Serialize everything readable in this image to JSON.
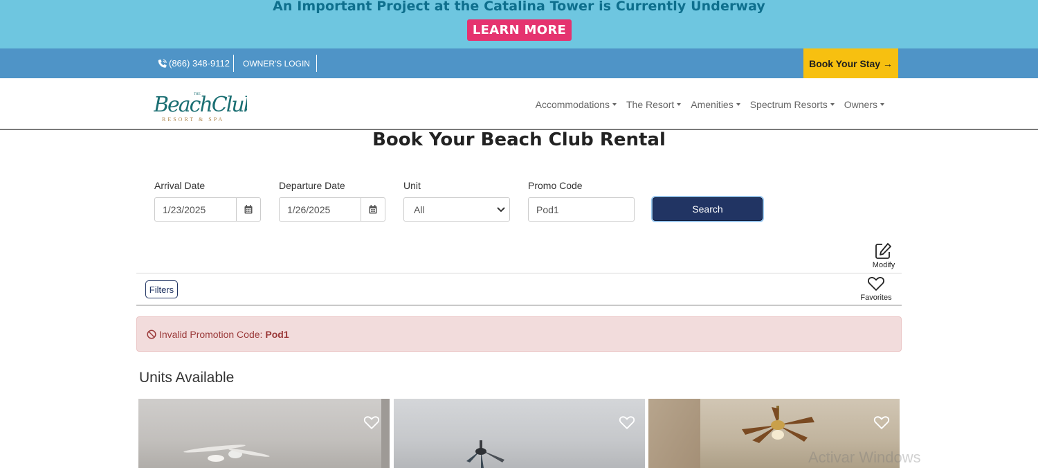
{
  "banner": {
    "title": "An Important Project at the Catalina Tower is Currently Underway",
    "button_label": "LEARN MORE"
  },
  "topbar": {
    "phone": "(866) 348-9112",
    "owner_login": "OWNER'S LOGIN",
    "book_stay": "Book Your Stay →"
  },
  "logo": {
    "the": "THE",
    "name": "BeachClub",
    "tagline": "RESORT & SPA"
  },
  "nav": {
    "items": [
      {
        "label": "Accommodations"
      },
      {
        "label": "The Resort"
      },
      {
        "label": "Amenities"
      },
      {
        "label": "Spectrum Resorts"
      },
      {
        "label": "Owners"
      }
    ]
  },
  "page": {
    "title": "Book Your Beach Club Rental"
  },
  "form": {
    "arrival_label": "Arrival Date",
    "arrival_value": "1/23/2025",
    "departure_label": "Departure Date",
    "departure_value": "1/26/2025",
    "unit_label": "Unit",
    "unit_value": "All",
    "promo_label": "Promo Code",
    "promo_value": "Pod1",
    "search_label": "Search"
  },
  "toolbar": {
    "modify_label": "Modify",
    "filters_label": "Filters",
    "favorites_label": "Favorites"
  },
  "alert": {
    "message": "Invalid Promotion Code:",
    "code": "Pod1"
  },
  "units": {
    "title": "Units Available"
  },
  "os": {
    "watermark": "Activar Windows"
  },
  "colors": {
    "banner_bg": "#6ec6e0",
    "learn_more": "#e5336f",
    "topbar": "#4f94c7",
    "book_stay": "#f7c010",
    "search_btn": "#213463",
    "alert_bg": "#f2dcdc",
    "alert_text": "#9b3a3a",
    "logo_teal": "#1b6f73"
  }
}
